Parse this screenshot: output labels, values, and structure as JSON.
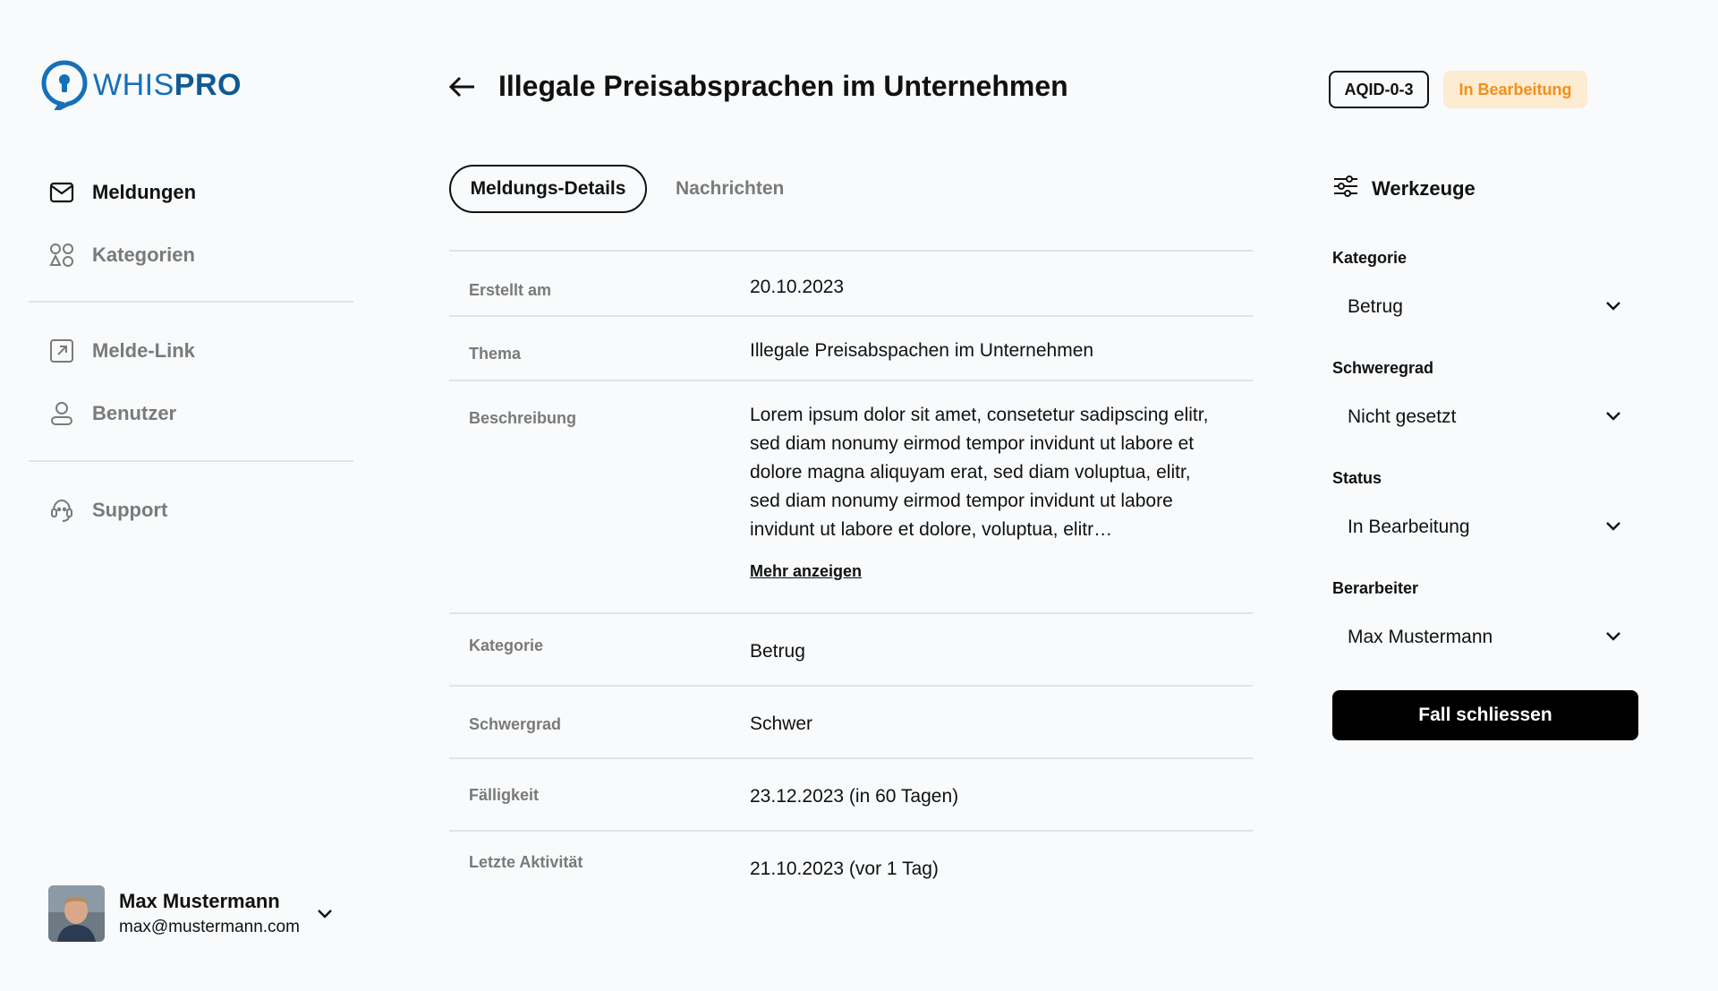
{
  "brand": {
    "name_light": "WHIS",
    "name_bold": "PRO",
    "color": "#1670b8"
  },
  "sidebar": {
    "items": [
      {
        "label": "Meldungen",
        "icon": "mail-icon",
        "active": true
      },
      {
        "label": "Kategorien",
        "icon": "categories-icon",
        "active": false
      },
      {
        "label": "Melde-Link",
        "icon": "external-link-icon",
        "active": false
      },
      {
        "label": "Benutzer",
        "icon": "user-icon",
        "active": false
      },
      {
        "label": "Support",
        "icon": "support-headset-icon",
        "active": false
      }
    ]
  },
  "user": {
    "name": "Max Mustermann",
    "email": "max@mustermann.com"
  },
  "header": {
    "title": "Illegale Preisabsprachen im Unternehmen",
    "case_id": "AQID-0-3",
    "status": "In Bearbeitung",
    "status_color": "#f0901a"
  },
  "tabs": [
    {
      "label": "Meldungs-Details",
      "active": true
    },
    {
      "label": "Nachrichten",
      "active": false
    }
  ],
  "details": [
    {
      "label": "Erstellt am",
      "value": "20.10.2023"
    },
    {
      "label": "Thema",
      "value": "Illegale Preisabspachen im Unternehmen"
    },
    {
      "label": "Beschreibung",
      "value": "Lorem ipsum dolor sit amet, consetetur sadipscing elitr, sed diam nonumy eirmod tempor invidunt ut labore et dolore magna aliquyam erat, sed diam voluptua,  elitr, sed diam nonumy eirmod tempor invidunt ut labore invidunt ut labore et dolore, voluptua,  elitr…"
    },
    {
      "label": "Kategorie",
      "value": "Betrug"
    },
    {
      "label": "Schwergrad",
      "value": "Schwer"
    },
    {
      "label": "Fälligkeit",
      "value": "23.12.2023 (in 60 Tagen)"
    },
    {
      "label": "Letzte Aktivität",
      "value": "21.10.2023 (vor 1 Tag)"
    }
  ],
  "more_link": "Mehr anzeigen",
  "tools": {
    "title": "Werkzeuge",
    "fields": [
      {
        "label": "Kategorie",
        "value": "Betrug"
      },
      {
        "label": "Schweregrad",
        "value": "Nicht gesetzt"
      },
      {
        "label": "Status",
        "value": "In Bearbeitung"
      },
      {
        "label": "Berarbeiter",
        "value": "Max Mustermann"
      }
    ],
    "close_button": "Fall schliessen"
  }
}
